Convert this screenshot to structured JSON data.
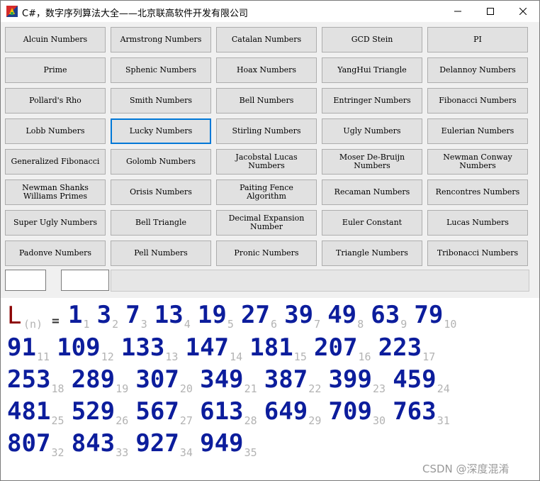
{
  "window": {
    "title": "C#，数字序列算法大全——北京联高软件开发有限公司",
    "minimize_icon": "minimize-icon",
    "maximize_icon": "maximize-icon",
    "close_icon": "close-icon"
  },
  "buttons": [
    [
      "Alcuin Numbers",
      "Armstrong Numbers",
      "Catalan Numbers",
      "GCD Stein",
      "PI"
    ],
    [
      "Prime",
      "Sphenic Numbers",
      "Hoax Numbers",
      "YangHui Triangle",
      "Delannoy Numbers"
    ],
    [
      "Pollard's Rho",
      "Smith Numbers",
      "Bell Numbers",
      "Entringer Numbers",
      "Fibonacci Numbers"
    ],
    [
      "Lobb Numbers",
      "Lucky Numbers",
      "Stirling Numbers",
      "Ugly Numbers",
      "Eulerian Numbers"
    ],
    [
      "Generalized Fibonacci",
      "Golomb Numbers",
      "Jacobstal Lucas Numbers",
      "Moser De-Bruijn Numbers",
      "Newman Conway Numbers"
    ],
    [
      "Newman Shanks Williams Primes",
      "Orisis Numbers",
      "Paiting Fence Algorithm",
      "Recaman Numbers",
      "Rencontres Numbers"
    ],
    [
      "Super Ugly Numbers",
      "Bell Triangle",
      "Decimal Expansion Number",
      "Euler Constant",
      "Lucas Numbers"
    ],
    [
      "Padonve Numbers",
      "Pell Numbers",
      "Pronic Numbers",
      "Triangle Numbers",
      "Tribonacci Numbers"
    ]
  ],
  "focused_button": "Lucky Numbers",
  "inputs": {
    "input_a": "",
    "input_b": ""
  },
  "output": {
    "letter": "L",
    "subscript": "(n)",
    "equals": "=",
    "values": [
      1,
      3,
      7,
      13,
      19,
      27,
      39,
      49,
      63,
      79,
      91,
      109,
      133,
      147,
      181,
      207,
      223,
      253,
      289,
      307,
      349,
      387,
      399,
      459,
      481,
      529,
      567,
      613,
      649,
      709,
      763,
      807,
      843,
      927,
      949
    ],
    "number_color": "#0c1d9c",
    "index_color": "#b3b3b3",
    "letter_color": "#8b0000"
  },
  "watermark": "CSDN @深度混淆"
}
